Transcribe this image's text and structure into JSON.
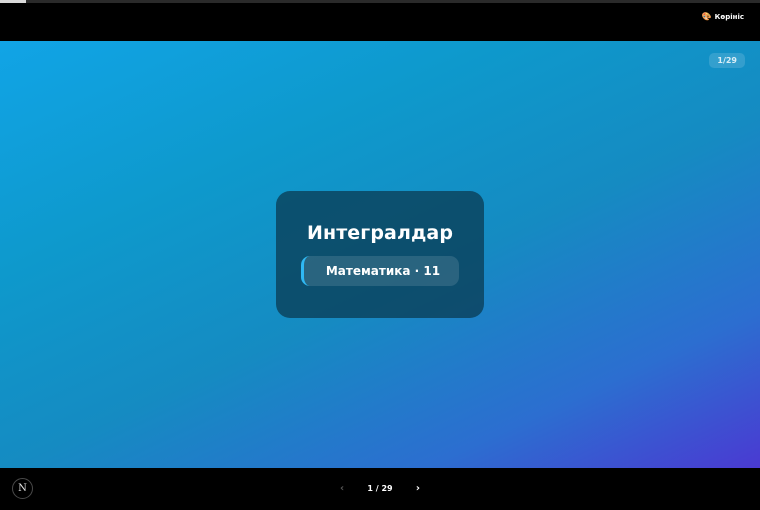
{
  "progress": {
    "fraction": 0.0345
  },
  "topbar": {
    "view_label": "Көрініс",
    "view_icon": "palette-icon"
  },
  "slide": {
    "counter": "1/29",
    "title": "Интегралдар",
    "subtitle": "Математика · 11"
  },
  "footer": {
    "logo": "N",
    "prev_glyph": "‹",
    "page_indicator": "1 / 29",
    "next_glyph": "›"
  },
  "colors": {
    "gradient_start": "#11a4e6",
    "gradient_end": "#4a3ad2",
    "card_bg": "#0a3e56",
    "accent": "#2fb8f3"
  }
}
